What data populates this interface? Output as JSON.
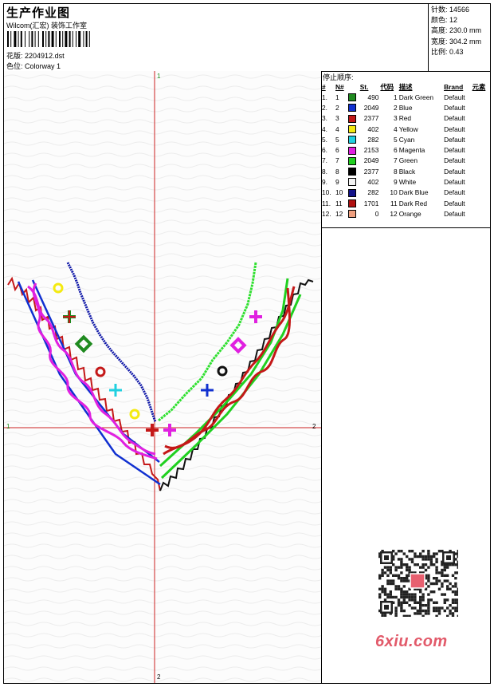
{
  "header": {
    "title": "生产作业图",
    "company": "Wilcom(汇宏) 装饰工作室",
    "file_label": "花版:",
    "file_name": "2204912.dst",
    "colorway_label": "色位:",
    "colorway": "Colorway 1"
  },
  "stats": {
    "stitches_label": "针数:",
    "stitches": "14566",
    "colors_label": "颜色:",
    "colors": "12",
    "height_label": "高度:",
    "height": "230.0 mm",
    "width_label": "宽度:",
    "width": "304.2 mm",
    "scale_label": "比例:",
    "scale": "0.43"
  },
  "stop_sequence": {
    "title": "停止顺序:",
    "headers": [
      "#",
      "N#",
      "St.",
      "代码",
      "描述",
      "Brand",
      "元素"
    ],
    "rows": [
      {
        "idx": "1.",
        "n": "1",
        "st": "490",
        "code": "1",
        "desc": "Dark Green",
        "brand": "Default",
        "color": "#1f8a1f"
      },
      {
        "idx": "2.",
        "n": "2",
        "st": "2049",
        "code": "2",
        "desc": "Blue",
        "brand": "Default",
        "color": "#1030d0"
      },
      {
        "idx": "3.",
        "n": "3",
        "st": "2377",
        "code": "3",
        "desc": "Red",
        "brand": "Default",
        "color": "#c01818"
      },
      {
        "idx": "4.",
        "n": "4",
        "st": "402",
        "code": "4",
        "desc": "Yellow",
        "brand": "Default",
        "color": "#f4ea10"
      },
      {
        "idx": "5.",
        "n": "5",
        "st": "282",
        "code": "5",
        "desc": "Cyan",
        "brand": "Default",
        "color": "#20d0e0"
      },
      {
        "idx": "6.",
        "n": "6",
        "st": "2153",
        "code": "6",
        "desc": "Magenta",
        "brand": "Default",
        "color": "#e020e0"
      },
      {
        "idx": "7.",
        "n": "7",
        "st": "2049",
        "code": "7",
        "desc": "Green",
        "brand": "Default",
        "color": "#20d020"
      },
      {
        "idx": "8.",
        "n": "8",
        "st": "2377",
        "code": "8",
        "desc": "Black",
        "brand": "Default",
        "color": "#000000"
      },
      {
        "idx": "9.",
        "n": "9",
        "st": "402",
        "code": "9",
        "desc": "White",
        "brand": "Default",
        "color": "#f4f4f4"
      },
      {
        "idx": "10.",
        "n": "10",
        "st": "282",
        "code": "10",
        "desc": "Dark Blue",
        "brand": "Default",
        "color": "#12128a"
      },
      {
        "idx": "11.",
        "n": "11",
        "st": "1701",
        "code": "11",
        "desc": "Dark Red",
        "brand": "Default",
        "color": "#b01010"
      },
      {
        "idx": "12.",
        "n": "12",
        "st": "0",
        "code": "12",
        "desc": "Orange",
        "brand": "Default",
        "color": "#f0a080"
      }
    ]
  },
  "axes": {
    "top": "1",
    "left": "1",
    "right": "2",
    "bottom": "2"
  },
  "watermark": "6xiu.com"
}
